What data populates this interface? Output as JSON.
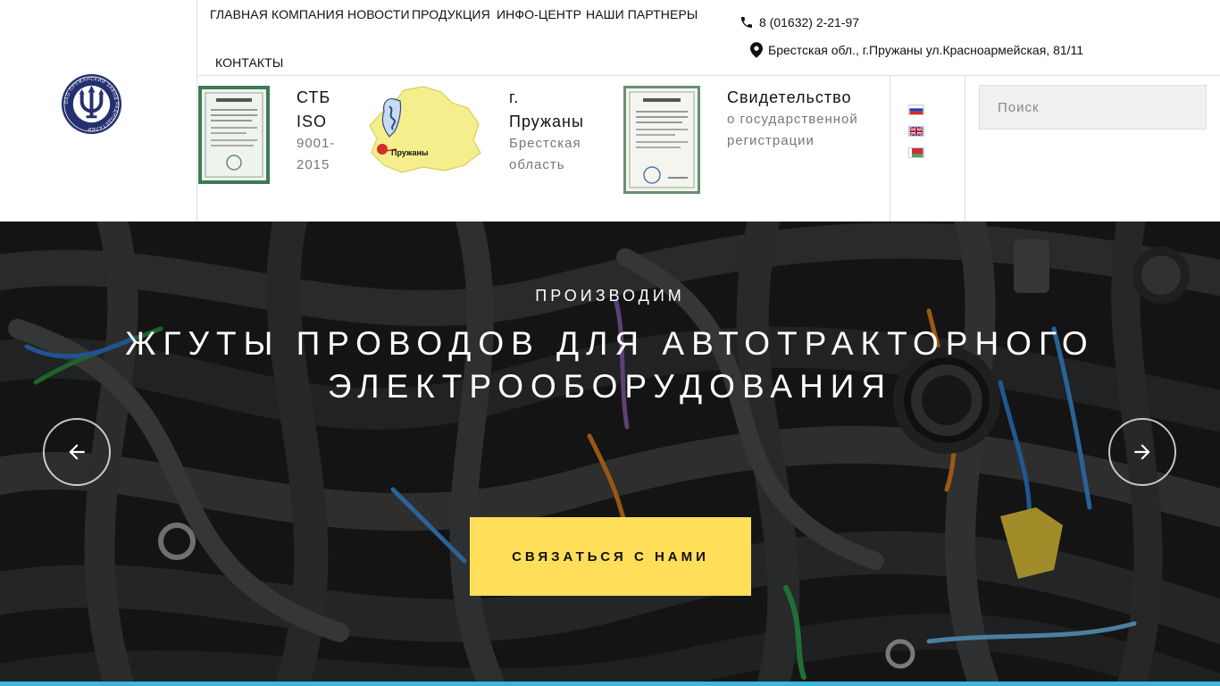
{
  "nav": {
    "items": [
      {
        "label": "ГЛАВНАЯ"
      },
      {
        "label": "КОМПАНИЯ"
      },
      {
        "label": "НОВОСТИ"
      },
      {
        "label": "ПРОДУКЦИЯ"
      },
      {
        "label": "ИНФО-ЦЕНТР"
      },
      {
        "label": "НАШИ ПАРТНЕРЫ"
      },
      {
        "label": "КОНТАКТЫ"
      }
    ]
  },
  "contacts": {
    "phone": "8 (01632) 2-21-97",
    "address": "Брестская обл., г.Пружаны ул.Красноармейская, 81/11"
  },
  "logo": {
    "text": "ОАО ПРУЖАНСКИЙ ЗАВОД РАДИОДЕТАЛЕЙ"
  },
  "certs": [
    {
      "title_lines": [
        "СТБ",
        "ISO"
      ],
      "sub_lines": [
        "9001-",
        "2015"
      ]
    },
    {
      "title_lines": [
        "г.",
        "Пружаны"
      ],
      "sub_lines": [
        "Брестская",
        "область"
      ],
      "map_label": "Пружаны"
    },
    {
      "title_lines": [
        "Свидетельство"
      ],
      "sub_lines": [
        "о государственной",
        "регистрации"
      ]
    }
  ],
  "languages": [
    "ru",
    "en",
    "by"
  ],
  "search": {
    "placeholder": "Поиск"
  },
  "hero": {
    "kicker": "ПРОИЗВОДИМ",
    "title": "ЖГУТЫ ПРОВОДОВ ДЛЯ АВТОТРАКТОРНОГО ЭЛЕКТРООБОРУДОВАНИЯ",
    "cta": "СВЯЗАТЬСЯ С НАМИ"
  },
  "colors": {
    "accent_yellow": "#ffde5a",
    "accent_blue": "#3db6de",
    "logo_navy": "#24306f"
  }
}
